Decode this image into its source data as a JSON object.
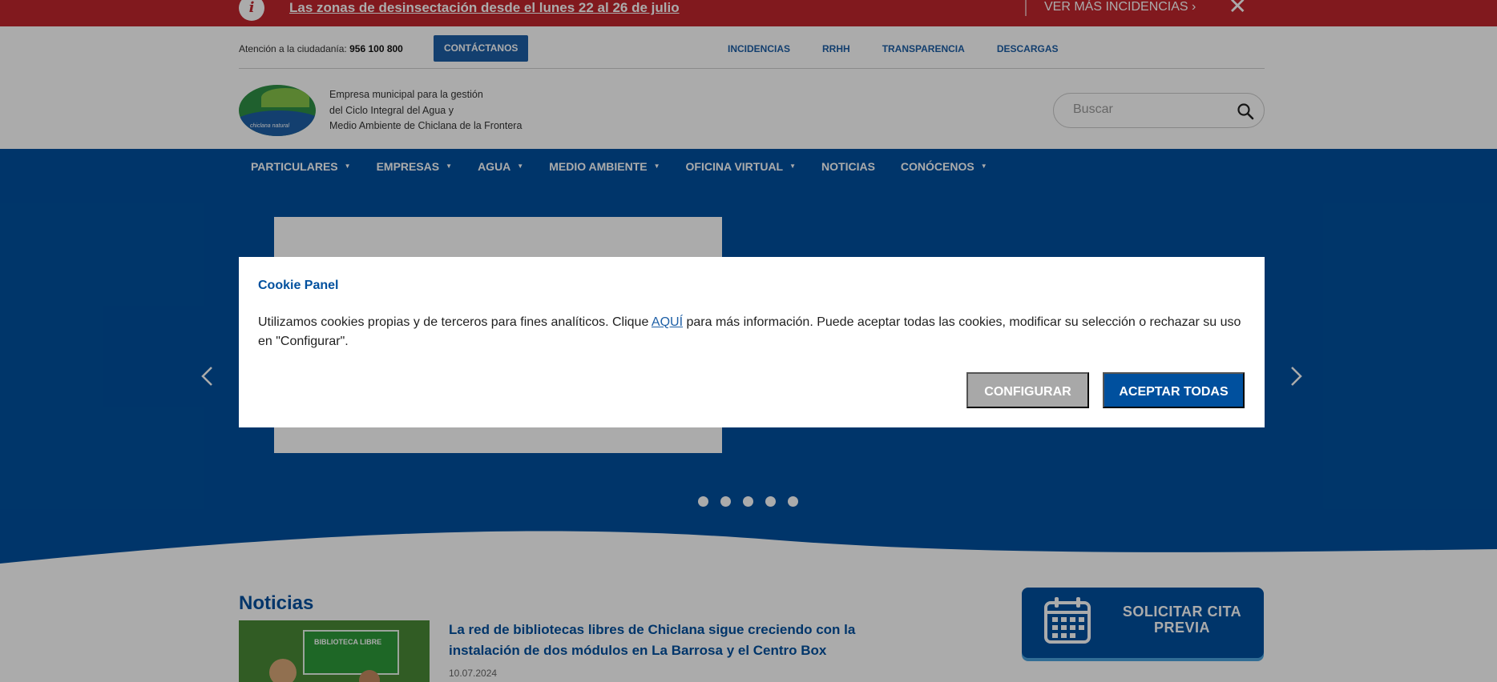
{
  "alert": {
    "icon": "info-icon",
    "text": "Las zonas de desinsectación desde el lunes 22 al 26 de julio",
    "more_label": "VER MÁS INCIDENCIAS",
    "close_icon": "close-icon"
  },
  "utility": {
    "atencion_label": "Atención a la ciudadanía:",
    "phone": "956 100 800",
    "contact_button": "CONTÁCTANOS",
    "links": [
      "INCIDENCIAS",
      "RRHH",
      "TRANSPARENCIA",
      "DESCARGAS"
    ]
  },
  "header": {
    "logo_text": "chiclana natural",
    "tagline_lines": [
      "Empresa municipal para la gestión",
      "del Ciclo Integral del Agua y",
      "Medio Ambiente de Chiclana de la Frontera"
    ],
    "search_placeholder": "Buscar"
  },
  "nav": {
    "items": [
      {
        "label": "PARTICULARES",
        "has_dropdown": true
      },
      {
        "label": "EMPRESAS",
        "has_dropdown": true
      },
      {
        "label": "AGUA",
        "has_dropdown": true
      },
      {
        "label": "MEDIO AMBIENTE",
        "has_dropdown": true
      },
      {
        "label": "OFICINA VIRTUAL",
        "has_dropdown": true
      },
      {
        "label": "NOTICIAS",
        "has_dropdown": false
      },
      {
        "label": "CONÓCENOS",
        "has_dropdown": true
      }
    ],
    "caret": "▼"
  },
  "carousel": {
    "slide_count": 5,
    "active_index": 0
  },
  "news": {
    "section_title": "Noticias",
    "items": [
      {
        "headline": "La red de bibliotecas libres de Chiclana sigue creciendo con la instalación de dos módulos en La Barrosa y el Centro Box",
        "date": "10.07.2024",
        "thumb_sign": "BIBLIOTECA LIBRE"
      }
    ]
  },
  "cita": {
    "label": "SOLICITAR CITA PREVIA",
    "icon": "calendar-icon"
  },
  "cookie_panel": {
    "title": "Cookie Panel",
    "text_before": "Utilizamos cookies propias y de terceros para fines analíticos. Clique ",
    "link_text": "AQUÍ",
    "text_after": " para más información. Puede aceptar todas las cookies, modificar su selección o rechazar su uso en \"Configurar\".",
    "configure_label": "CONFIGURAR",
    "accept_label": "ACEPTAR TODAS"
  },
  "colors": {
    "alert_red": "#c0262d",
    "brand_blue": "#00509e",
    "link_blue": "#1d5fa6",
    "config_gray": "#a8a8a8"
  }
}
